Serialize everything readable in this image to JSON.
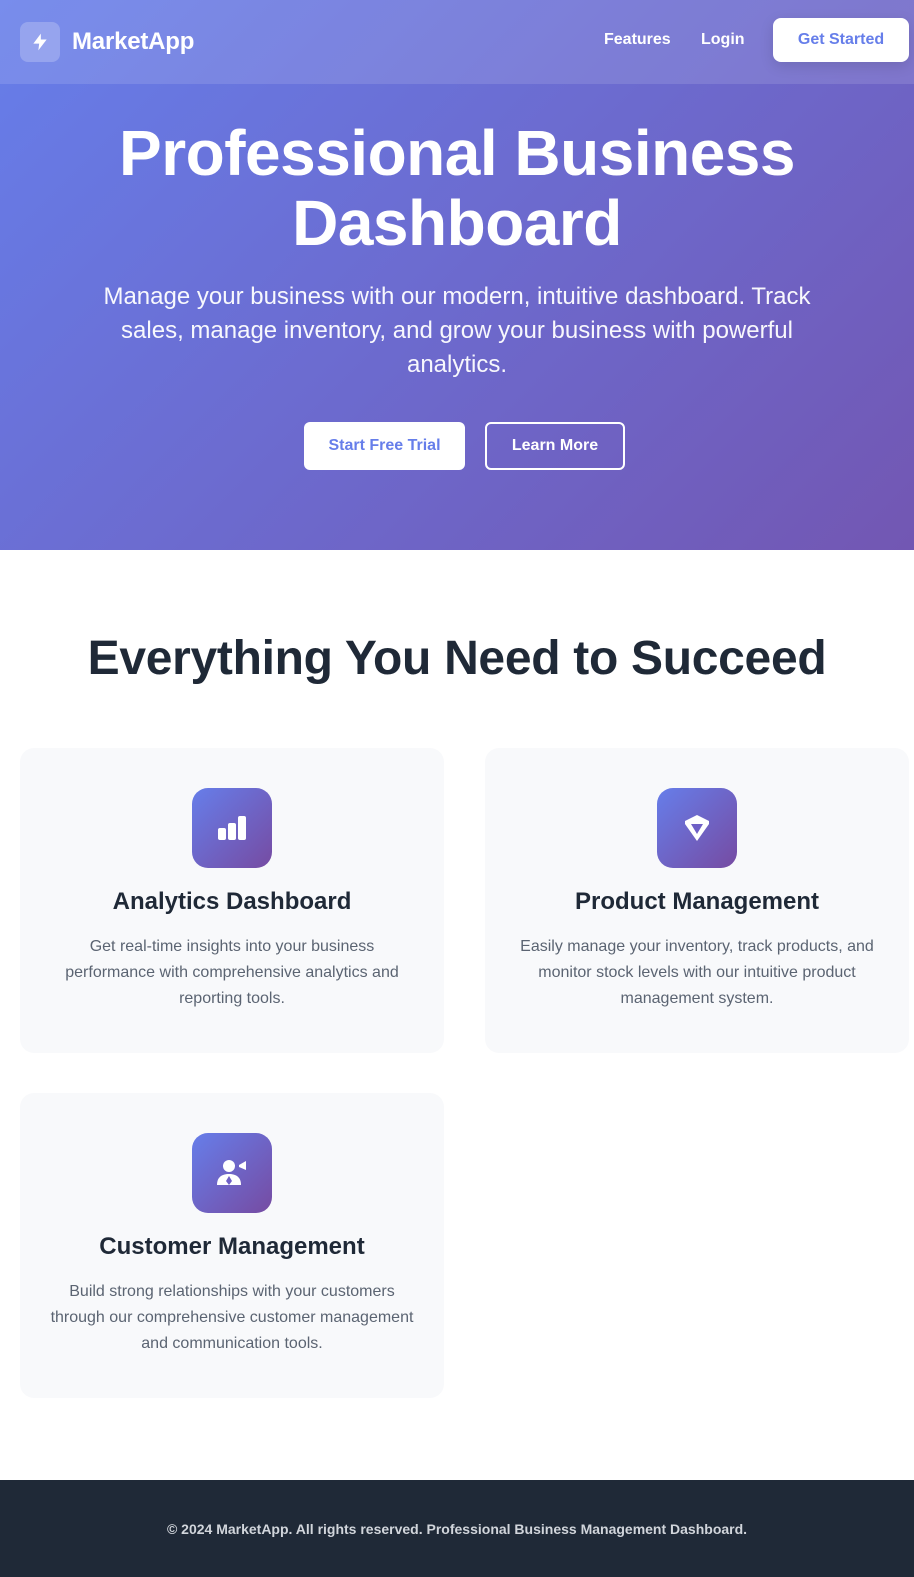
{
  "colors": {
    "gradient_start": "#667eea",
    "gradient_end": "#764ba2",
    "footer_bg": "#1f2937",
    "card_bg": "#f8f9fb",
    "text_dark": "#1f2937",
    "text_muted": "#5b6472"
  },
  "navbar": {
    "brand_icon": "lightning-bolt-icon",
    "brand_name": "MarketApp",
    "links": [
      {
        "label": "Features"
      },
      {
        "label": "Login"
      }
    ],
    "cta_label": "Get Started"
  },
  "hero": {
    "title": "Professional Business Dashboard",
    "subtitle": "Manage your business with our modern, intuitive dashboard. Track sales, manage inventory, and grow your business with powerful analytics.",
    "primary_button": "Start Free Trial",
    "secondary_button": "Learn More"
  },
  "features": {
    "title": "Everything You Need to Succeed",
    "cards": [
      {
        "icon": "bar-chart-icon",
        "title": "Analytics Dashboard",
        "description": "Get real-time insights into your business performance with comprehensive analytics and reporting tools."
      },
      {
        "icon": "box-icon",
        "title": "Product Management",
        "description": "Easily manage your inventory, track products, and monitor stock levels with our intuitive product management system."
      },
      {
        "icon": "users-icon",
        "title": "Customer Management",
        "description": "Build strong relationships with your customers through our comprehensive customer management and communication tools."
      }
    ]
  },
  "footer": {
    "text": "© 2024 MarketApp. All rights reserved. Professional Business Management Dashboard."
  }
}
